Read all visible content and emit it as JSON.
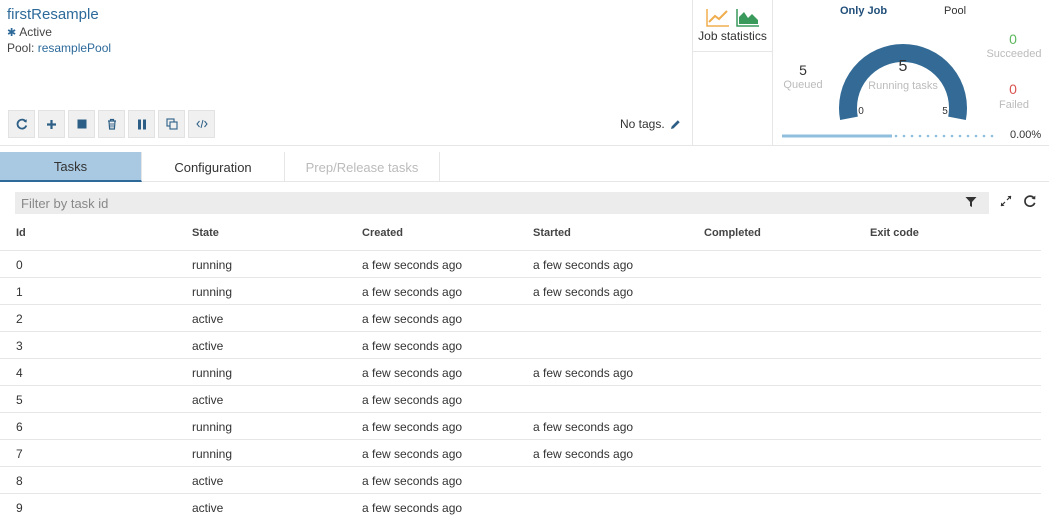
{
  "job": {
    "title": "firstResample",
    "state": "Active",
    "pool_label": "Pool:",
    "pool_name": "resamplePool"
  },
  "toolbar": {
    "buttons": [
      "refresh-icon",
      "add-icon",
      "stop-icon",
      "delete-icon",
      "pause-icon",
      "clone-icon",
      "code-icon"
    ]
  },
  "tags": {
    "text": "No tags."
  },
  "job_statistics": {
    "label": "Job statistics"
  },
  "gauge": {
    "tabs": [
      "Only Job",
      "Pool"
    ],
    "queued_value": "5",
    "queued_label": "Queued",
    "running_value": "5",
    "running_label": "Running tasks",
    "min_label": "0",
    "max_label": "5",
    "running_fraction": 1.0,
    "succeeded_value": "0",
    "succeeded_label": "Succeeded",
    "failed_value": "0",
    "failed_label": "Failed",
    "progress_text": "0.00%",
    "progress_fraction": 0.0,
    "colors": {
      "gauge": "#336b96",
      "succeeded": "#5cb85c",
      "failed": "#d9534f",
      "progress": "#8fbfdc"
    }
  },
  "tabs": {
    "tasks": "Tasks",
    "configuration": "Configuration",
    "prep_release": "Prep/Release tasks"
  },
  "filter": {
    "placeholder": "Filter by task id"
  },
  "table": {
    "headers": {
      "id": "Id",
      "state": "State",
      "created": "Created",
      "started": "Started",
      "completed": "Completed",
      "exit_code": "Exit code"
    },
    "rows": [
      {
        "id": "0",
        "state": "running",
        "created": "a few seconds ago",
        "started": "a few seconds ago",
        "completed": "",
        "exit_code": ""
      },
      {
        "id": "1",
        "state": "running",
        "created": "a few seconds ago",
        "started": "a few seconds ago",
        "completed": "",
        "exit_code": ""
      },
      {
        "id": "2",
        "state": "active",
        "created": "a few seconds ago",
        "started": "",
        "completed": "",
        "exit_code": ""
      },
      {
        "id": "3",
        "state": "active",
        "created": "a few seconds ago",
        "started": "",
        "completed": "",
        "exit_code": ""
      },
      {
        "id": "4",
        "state": "running",
        "created": "a few seconds ago",
        "started": "a few seconds ago",
        "completed": "",
        "exit_code": ""
      },
      {
        "id": "5",
        "state": "active",
        "created": "a few seconds ago",
        "started": "",
        "completed": "",
        "exit_code": ""
      },
      {
        "id": "6",
        "state": "running",
        "created": "a few seconds ago",
        "started": "a few seconds ago",
        "completed": "",
        "exit_code": ""
      },
      {
        "id": "7",
        "state": "running",
        "created": "a few seconds ago",
        "started": "a few seconds ago",
        "completed": "",
        "exit_code": ""
      },
      {
        "id": "8",
        "state": "active",
        "created": "a few seconds ago",
        "started": "",
        "completed": "",
        "exit_code": ""
      },
      {
        "id": "9",
        "state": "active",
        "created": "a few seconds ago",
        "started": "",
        "completed": "",
        "exit_code": ""
      }
    ]
  }
}
